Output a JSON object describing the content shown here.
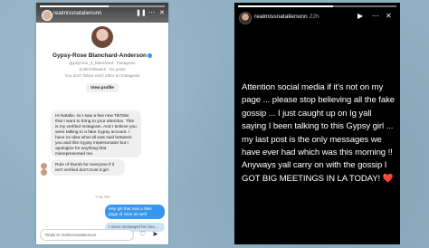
{
  "left_panel": {
    "story_user": "realmissnatalienunn",
    "dm": {
      "display_name": "Gypsy-Rose Blanchard-Anderson",
      "handle_line": "gypsyrose_a_blanchard · Instagram",
      "stats": "8.3M followers · 81 posts",
      "note": "You don't follow each other on Instagram",
      "view_profile_label": "View profile",
      "messages_in": [
        "Hi Natalie, so I saw a few new TikToks that I want to bring to your attention. This is my verified Instagram. And I believe you were talking to a fake Gypsy account. I have no idea what all was said between you and this Gypsy impersonator but I apologize for anything that misrepresented me.",
        "Rule of thumb for everyone if it isn't verified don't trust it girl"
      ],
      "time_label": "7:16 AM",
      "message_out": "Hey girl that was a fake page of mine as well",
      "message_out_2": "I never messaged her bac...",
      "reply_placeholder": "Reply to realmissnatalienunn"
    }
  },
  "right_panel": {
    "user": "realmissnatalienunn",
    "time_ago": "22h",
    "story_text": "Attention social media if it's not on my page ... please stop believing all the fake gossip ... I just caught up on Ig yall saying I been talking to this Gypsy girl ... my last post is the only messages we have ever had which was this morning !! Anyways yall carry on with the gossip I GOT BIG MEETINGS IN LA TODAY!",
    "heart_emoji": "❤️"
  },
  "colors": {
    "background": "#8fb0c2",
    "dm_blue": "#3797f0",
    "story_bg": "#000000"
  }
}
